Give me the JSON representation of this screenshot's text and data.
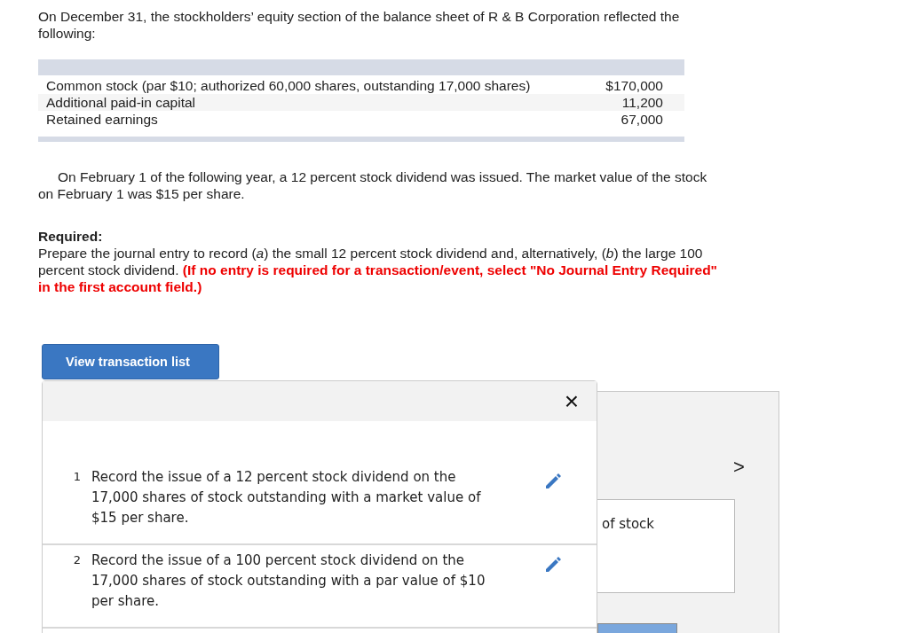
{
  "intro": "On December 31, the stockholders’ equity section of the balance sheet of R & B Corporation reflected the following:",
  "balance_rows": [
    {
      "label": "Common stock (par $10; authorized 60,000 shares, outstanding 17,000 shares)",
      "amount": "$170,000"
    },
    {
      "label": "Additional paid-in capital",
      "amount": "11,200"
    },
    {
      "label": "Retained earnings",
      "amount": "67,000"
    }
  ],
  "event": "On February 1 of the following year, a 12 percent stock dividend was issued. The market value of the stock on February 1 was $15 per share.",
  "required_heading": "Required:",
  "required_text": "Prepare the journal entry to record (*a*) the small 12 percent stock dividend and, alternatively, (*b*) the large 100 percent stock dividend.",
  "required_note": "(If no entry is required for a transaction/event, select \"No Journal Entry Required\" in the first account field.)",
  "view_button": "View transaction list",
  "close_symbol": "×",
  "transactions": [
    {
      "number": "1",
      "text": "Record the issue of a 12 percent stock dividend on the 17,000 shares of stock outstanding with a market value of $15 per share."
    },
    {
      "number": "2",
      "text": "Record the issue of a 100 percent stock dividend on the 17,000 shares of stock outstanding with a par value of $10 per share."
    }
  ],
  "behind_panel": {
    "next_symbol": ">",
    "text": "of stock"
  }
}
